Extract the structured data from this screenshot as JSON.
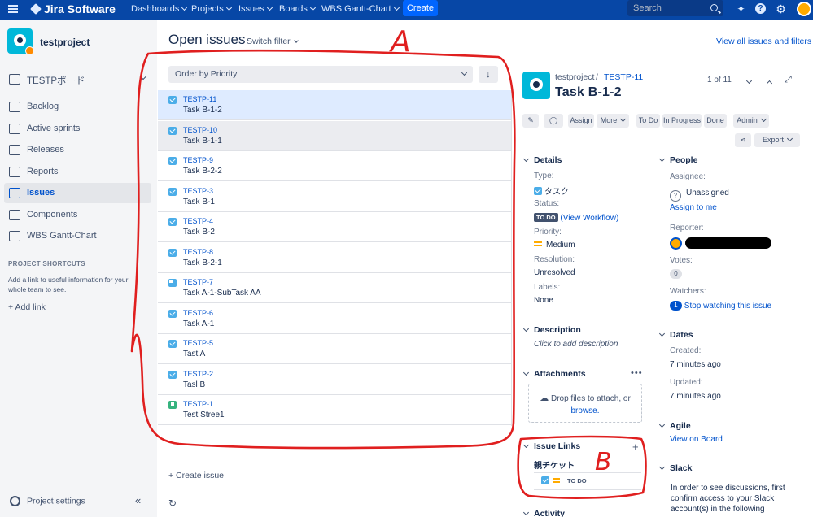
{
  "nav": {
    "brand": "Jira Software",
    "menus": [
      "Dashboards",
      "Projects",
      "Issues",
      "Boards",
      "WBS Gantt-Chart"
    ],
    "create_label": "Create",
    "search_placeholder": "Search",
    "icons": [
      "menu-icon",
      "jira-logo-icon",
      "notifications-icon",
      "help-icon",
      "settings-icon",
      "user-avatar"
    ]
  },
  "sidebar": {
    "project_name": "testproject",
    "board_label": "TESTPボード",
    "items": [
      {
        "label": "Backlog",
        "icon": "backlog-icon"
      },
      {
        "label": "Active sprints",
        "icon": "sprints-icon"
      },
      {
        "label": "Releases",
        "icon": "releases-icon"
      },
      {
        "label": "Reports",
        "icon": "reports-icon"
      },
      {
        "label": "Issues",
        "icon": "issues-icon",
        "active": true
      },
      {
        "label": "Components",
        "icon": "components-icon"
      },
      {
        "label": "WBS Gantt-Chart",
        "icon": "gantt-icon"
      }
    ],
    "shortcuts_title": "PROJECT SHORTCUTS",
    "shortcuts_text": "Add a link to useful information for your whole team to see.",
    "add_link": "+   Add link",
    "settings_label": "Project settings",
    "collapse_glyph": "«"
  },
  "main": {
    "title": "Open issues",
    "switch_filter": "Switch filter",
    "view_all": "View all issues and filters",
    "order_by": "Order by Priority",
    "sort_glyph": "↓",
    "issues": [
      {
        "key": "TESTP-11",
        "summary": "Task B-1-2",
        "type": "task",
        "selected": true
      },
      {
        "key": "TESTP-10",
        "summary": "Task B-1-1",
        "type": "task"
      },
      {
        "key": "TESTP-9",
        "summary": "Task B-2-2",
        "type": "task"
      },
      {
        "key": "TESTP-3",
        "summary": "Task B-1",
        "type": "task"
      },
      {
        "key": "TESTP-4",
        "summary": "Task B-2",
        "type": "task"
      },
      {
        "key": "TESTP-8",
        "summary": "Task B-2-1",
        "type": "task"
      },
      {
        "key": "TESTP-7",
        "summary": "Task A-1-SubTask AA",
        "type": "subtask"
      },
      {
        "key": "TESTP-6",
        "summary": "Task A-1",
        "type": "task"
      },
      {
        "key": "TESTP-5",
        "summary": "Tast A",
        "type": "task"
      },
      {
        "key": "TESTP-2",
        "summary": "Tasl B",
        "type": "task"
      },
      {
        "key": "TESTP-1",
        "summary": "Test Stree1",
        "type": "story"
      }
    ],
    "create_issue": "+ Create issue",
    "refresh_glyph": "↻"
  },
  "detail": {
    "breadcrumb_project": "testproject",
    "breadcrumb_sep": "/",
    "breadcrumb_key": "TESTP-11",
    "title": "Task B-1-2",
    "pager": "1 of 11",
    "expand_glyph": "⤢",
    "toolbar": {
      "edit_glyph": "✎",
      "comment_glyph": "◯",
      "assign": "Assign",
      "more": "More",
      "todo": "To Do",
      "in_progress": "In Progress",
      "done": "Done",
      "admin": "Admin",
      "share_glyph": "⋖",
      "export": "Export"
    },
    "details": {
      "header": "Details",
      "type_label": "Type:",
      "type_value": "タスク",
      "status_label": "Status:",
      "status_value": "TO DO",
      "view_workflow": "(View Workflow)",
      "priority_label": "Priority:",
      "priority_value": "Medium",
      "resolution_label": "Resolution:",
      "resolution_value": "Unresolved",
      "labels_label": "Labels:",
      "labels_value": "None"
    },
    "people": {
      "header": "People",
      "assignee_label": "Assignee:",
      "assignee_value": "Unassigned",
      "assign_to_me": "Assign to me",
      "reporter_label": "Reporter:",
      "votes_label": "Votes:",
      "votes_value": "0",
      "watchers_label": "Watchers:",
      "watchers_count": "1",
      "stop_watching": "Stop watching this issue"
    },
    "description": {
      "header": "Description",
      "placeholder": "Click to add description"
    },
    "attachments": {
      "header": "Attachments",
      "more": "•••",
      "drop_text": "Drop files to attach, or",
      "browse": "browse."
    },
    "issue_links": {
      "header": "Issue Links",
      "add": "+",
      "subheader": "親チケット",
      "row_status": "TO DO"
    },
    "activity": {
      "header": "Activity"
    },
    "dates": {
      "header": "Dates",
      "created_label": "Created:",
      "created_value": "7 minutes ago",
      "updated_label": "Updated:",
      "updated_value": "7 minutes ago"
    },
    "agile": {
      "header": "Agile",
      "view_on_board": "View on Board"
    },
    "slack": {
      "header": "Slack",
      "text": "In order to see discussions, first confirm access to your Slack account(s) in the following"
    }
  },
  "annotations": {
    "label_a": "A",
    "label_b": "B",
    "color": "#e01f1f"
  },
  "colors": {
    "nav": "#0747a6",
    "accent": "#0052cc",
    "sidebar": "#f4f5f7",
    "selected_row": "#deebff"
  }
}
